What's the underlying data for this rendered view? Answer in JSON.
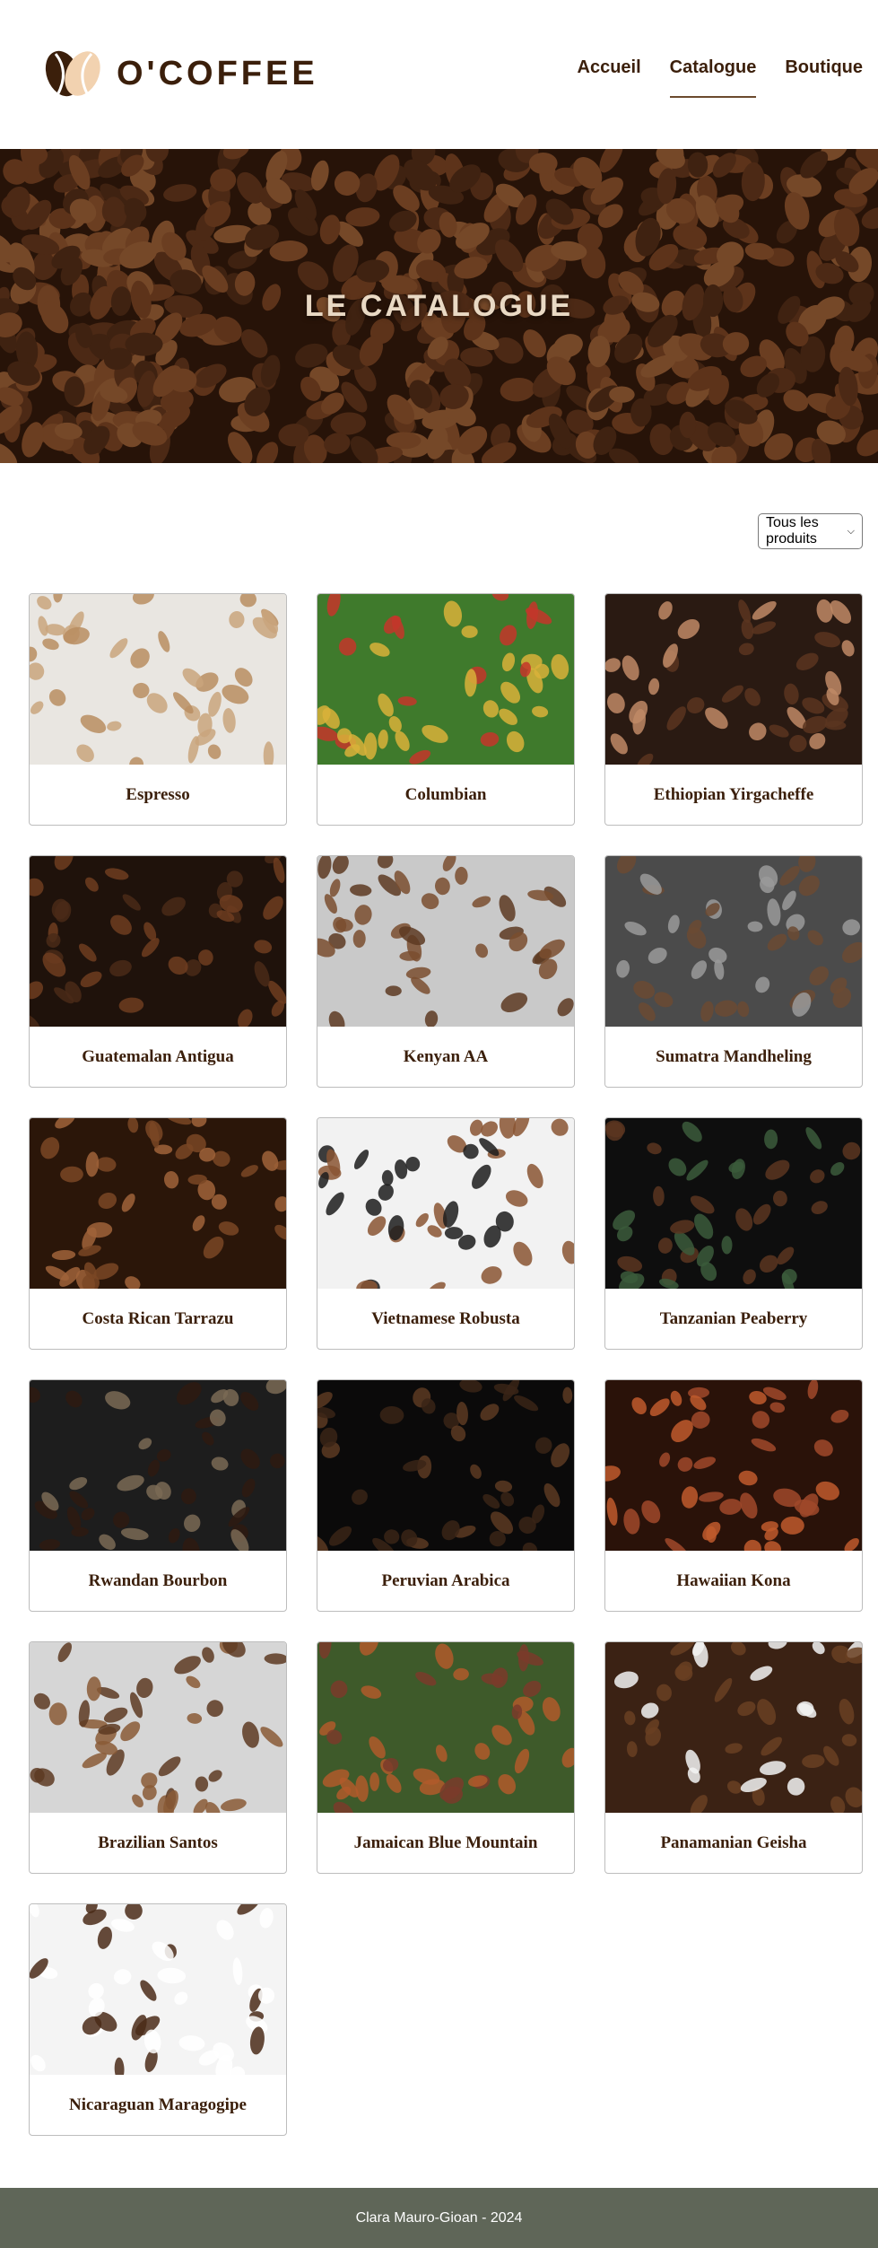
{
  "brand": {
    "name": "O'COFFEE",
    "colors": {
      "primary": "#3b1f0b",
      "accent": "#f2d2b0",
      "footer": "#5f6658"
    }
  },
  "nav": {
    "items": [
      {
        "label": "Accueil",
        "active": false
      },
      {
        "label": "Catalogue",
        "active": true
      },
      {
        "label": "Boutique",
        "active": false
      }
    ]
  },
  "hero": {
    "title": "LE CATALOGUE"
  },
  "filter": {
    "selected": "Tous les produits"
  },
  "products": [
    {
      "name": "Espresso",
      "image": "coffee-bags-photo"
    },
    {
      "name": "Columbian",
      "image": "coffee-cherries-photo"
    },
    {
      "name": "Ethiopian Yirgacheffe",
      "image": "beans-in-hands-photo"
    },
    {
      "name": "Guatemalan Antigua",
      "image": "dark-beans-photo"
    },
    {
      "name": "Kenyan AA",
      "image": "beans-in-bag-photo"
    },
    {
      "name": "Sumatra Mandheling",
      "image": "roaster-drum-photo"
    },
    {
      "name": "Costa Rican Tarrazu",
      "image": "closeup-beans-photo"
    },
    {
      "name": "Vietnamese Robusta",
      "image": "portafilter-beans-photo"
    },
    {
      "name": "Tanzanian Peaberry",
      "image": "scoop-beans-photo"
    },
    {
      "name": "Rwandan Bourbon",
      "image": "burlap-sack-photo"
    },
    {
      "name": "Peruvian Arabica",
      "image": "dark-spread-beans-photo"
    },
    {
      "name": "Hawaiian Kona",
      "image": "ground-coffee-photo"
    },
    {
      "name": "Brazilian Santos",
      "image": "open-bag-beans-photo"
    },
    {
      "name": "Jamaican Blue Mountain",
      "image": "coffee-plant-photo"
    },
    {
      "name": "Panamanian Geisha",
      "image": "cup-on-wood-photo"
    },
    {
      "name": "Nicaraguan Maragogipe",
      "image": "cup-saucer-beans-photo"
    }
  ],
  "footer": {
    "text": "Clara Mauro-Gioan - 2024"
  }
}
